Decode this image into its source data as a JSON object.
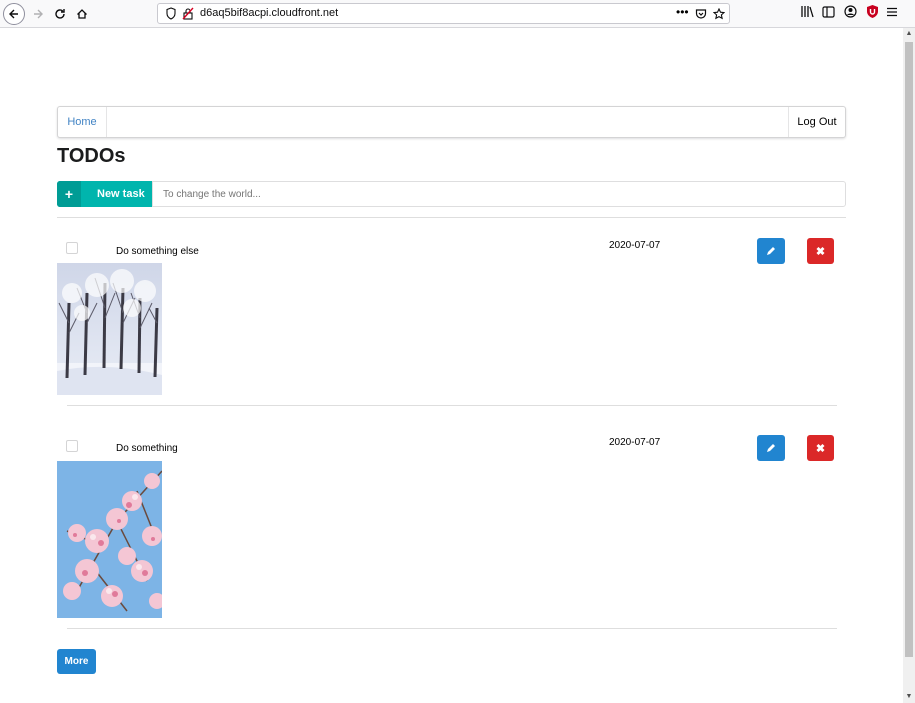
{
  "browser": {
    "url": "d6aq5bif8acpi.cloudfront.net",
    "icons": [
      "back-icon",
      "forward-icon",
      "reload-icon",
      "home-icon",
      "shield-icon",
      "insecure-lock-icon",
      "more-icon",
      "pocket-icon",
      "star-icon",
      "library-icon",
      "sidebar-icon",
      "account-icon",
      "ublock-icon",
      "menu-icon"
    ]
  },
  "nav": {
    "home_label": "Home",
    "logout_label": "Log Out"
  },
  "page": {
    "title": "TODOs"
  },
  "new_task": {
    "button_label": "New task",
    "placeholder": "To change the world..."
  },
  "todos": [
    {
      "name": "Do something else",
      "due_date": "2020-07-07",
      "done": false,
      "image": "snowy-forest"
    },
    {
      "name": "Do something",
      "due_date": "2020-07-07",
      "done": false,
      "image": "cherry-blossom"
    }
  ],
  "more_label": "More",
  "colors": {
    "teal": "#00b5ad",
    "blue": "#2185d0",
    "red": "#db2828",
    "link": "#4183c4"
  }
}
